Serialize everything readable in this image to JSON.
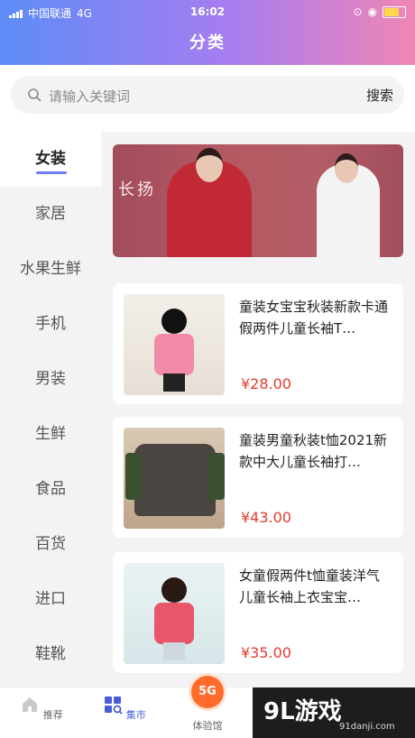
{
  "status_bar": {
    "carrier": "中国联通",
    "network": "4G",
    "time": "16:02"
  },
  "header": {
    "title": "分类"
  },
  "search": {
    "placeholder": "请输入关键词",
    "button_label": "搜索"
  },
  "watermark_logo": "91游戏",
  "sidebar": {
    "items": [
      {
        "label": "女装",
        "active": true
      },
      {
        "label": "家居"
      },
      {
        "label": "水果生鲜"
      },
      {
        "label": "手机"
      },
      {
        "label": "男装"
      },
      {
        "label": "生鲜"
      },
      {
        "label": "食品"
      },
      {
        "label": "百货"
      },
      {
        "label": "进口"
      },
      {
        "label": "鞋靴"
      }
    ]
  },
  "banner": {
    "text": "长扬"
  },
  "products": [
    {
      "title": "童装女宝宝秋装新款卡通假两件儿童长袖T…",
      "price": "¥28.00"
    },
    {
      "title": "童装男童秋装t恤2021新款中大儿童长袖打…",
      "price": "¥43.00"
    },
    {
      "title": "女童假两件t恤童装洋气儿童长袖上衣宝宝…",
      "price": "¥35.00"
    }
  ],
  "tabbar": {
    "tabs": [
      {
        "label": "推荐",
        "icon": "home-icon"
      },
      {
        "label": "集市",
        "icon": "market-icon",
        "active": true
      },
      {
        "label": "体验馆",
        "icon": "5g-icon",
        "badge": "5G"
      }
    ]
  },
  "bottom_watermark": {
    "brand": "9L游戏",
    "domain": "91danji.com"
  },
  "colors": {
    "accent": "#6f7cf5",
    "price": "#e43b30",
    "tab_active": "#4a5bd8"
  }
}
